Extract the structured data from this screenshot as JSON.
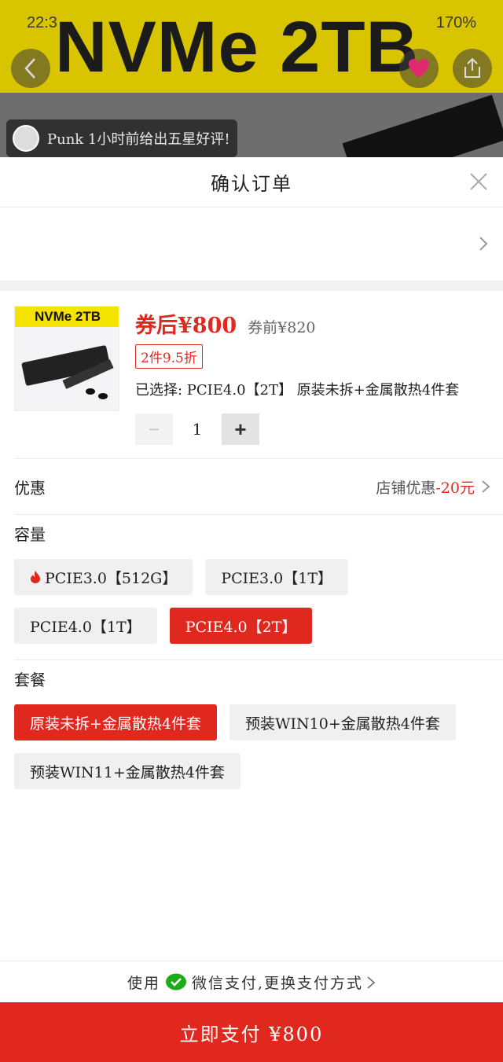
{
  "background": {
    "status_time": "22:3",
    "status_battery": "170%",
    "banner_text": "NVMe 2TB",
    "toast": "Punk 1小时前给出五星好评!"
  },
  "sheet": {
    "title": "确认订单"
  },
  "product": {
    "thumb_label": "NVMe 2TB",
    "price_now": "券后¥800",
    "price_before": "券前¥820",
    "discount": "2件9.5折",
    "selected": "已选择: PCIE4.0【2T】 原装未拆+金属散热4件套",
    "minus": "−",
    "quantity": "1",
    "plus": "+"
  },
  "promo": {
    "label": "优惠",
    "value_prefix": "店铺优惠",
    "value_amount": "-20元"
  },
  "capacity": {
    "title": "容量",
    "options": [
      "PCIE3.0【512G】",
      "PCIE3.0【1T】",
      "PCIE4.0【1T】",
      "PCIE4.0【2T】"
    ],
    "selected_index": 3
  },
  "package": {
    "title": "套餐",
    "options": [
      "原装未拆+金属散热4件套",
      "预装WIN10+金属散热4件套",
      "预装WIN11+金属散热4件套"
    ],
    "selected_index": 0
  },
  "payment": {
    "prefix": "使用",
    "method": "微信支付,更换支付方式",
    "button": "立即支付 ¥800"
  },
  "colors": {
    "accent": "#e0281f",
    "chip_bg": "#f0f0f0",
    "wechat": "#1aad19"
  }
}
